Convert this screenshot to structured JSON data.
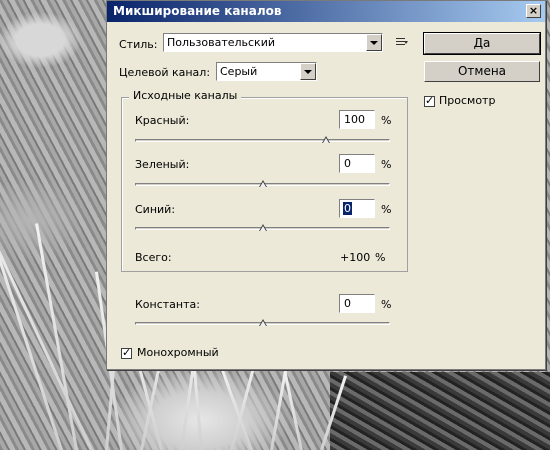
{
  "window": {
    "title": "Микширование каналов"
  },
  "style": {
    "label": "Стиль:",
    "value": "Пользовательский"
  },
  "target": {
    "label": "Целевой канал:",
    "value": "Серый"
  },
  "buttons": {
    "ok": "Да",
    "cancel": "Отмена"
  },
  "preview": {
    "label": "Просмотр",
    "checked": true
  },
  "source_group": {
    "label": "Исходные каналы",
    "channels": [
      {
        "label": "Красный:",
        "value": "100",
        "unit": "%",
        "slider_percent": 100
      },
      {
        "label": "Зеленый:",
        "value": "0",
        "unit": "%",
        "slider_percent": 0
      },
      {
        "label": "Синий:",
        "value": "0",
        "unit": "%",
        "slider_percent": 0
      }
    ],
    "total": {
      "label": "Всего:",
      "value": "+100",
      "unit": "%"
    }
  },
  "constant": {
    "label": "Константа:",
    "value": "0",
    "unit": "%",
    "slider_percent": 0
  },
  "monochrome": {
    "label": "Монохромный",
    "checked": true
  }
}
